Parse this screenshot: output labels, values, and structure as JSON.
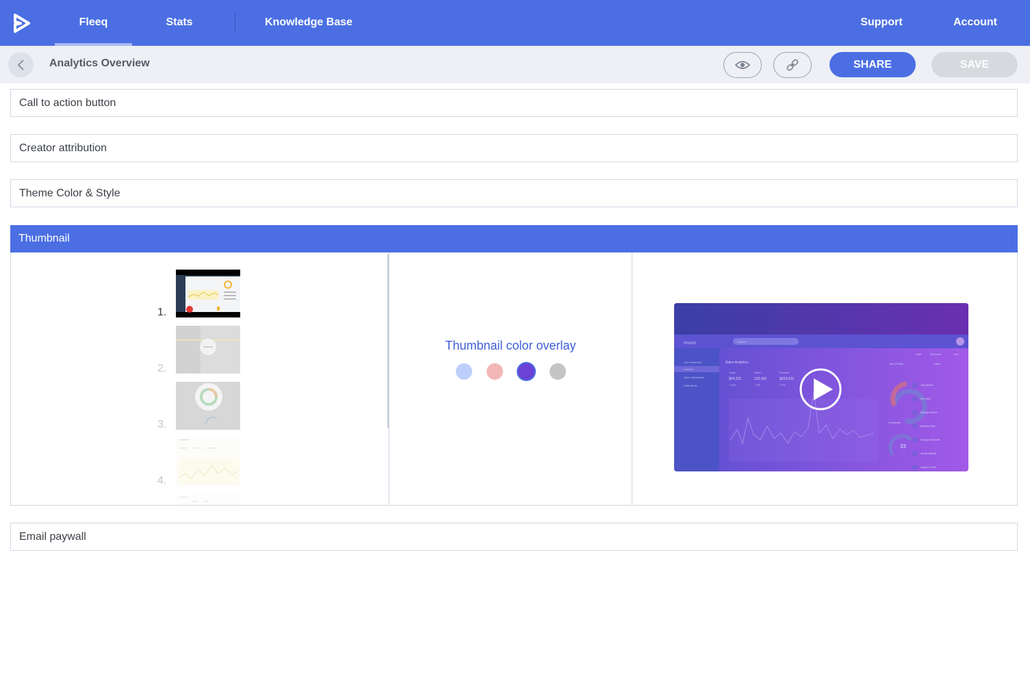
{
  "nav": {
    "items": [
      "Fleeq",
      "Stats",
      "Knowledge Base"
    ],
    "right_items": [
      "Support",
      "Account"
    ],
    "accent": "#4b6fe3"
  },
  "toolbar": {
    "title": "Analytics Overview",
    "share_label": "SHARE",
    "save_label": "SAVE"
  },
  "sections": {
    "cta": "Call to action button",
    "creator": "Creator attribution",
    "theme": "Theme Color & Style",
    "thumbnail": "Thumbnail",
    "email": "Email paywall"
  },
  "thumbnail": {
    "frames": [
      "1.",
      "2.",
      "3.",
      "4."
    ],
    "selected_frame": 1,
    "overlay_title": "Thumbnail color overlay",
    "overlay_colors": [
      "#bdd0fb",
      "#f3b7b7",
      "#6a43d6",
      "#c4c4c4"
    ],
    "selected_overlay": "#6a43d6",
    "preview": {
      "app_name": "Hound",
      "search_placeholder": "Search",
      "section_title": "Sales Analytics",
      "stats": [
        {
          "label": "Today",
          "value": "$24,222",
          "delta": "+ 10%"
        },
        {
          "label": "Active",
          "value": "123,432",
          "delta": "+ 4%"
        },
        {
          "label": "Revenue",
          "value": "$324,222",
          "delta": "+ 4%"
        }
      ],
      "sidebar_items": [
        "Your Dashboard",
        "Analytics",
        "Sales Optimization",
        "Notifications"
      ],
      "panel_title": "Top 5 Posts",
      "panel_tabs": [
        "Chat",
        "Messages",
        "Todo"
      ],
      "panel_select": "Users",
      "contacts": [
        "Clay Morris",
        "Zoe Hine",
        "Madelyn Burton",
        "Miranda Reid",
        "Claryard Meredith",
        "Jennie Metcalf",
        "Angela Lowell"
      ],
      "conversion_label": "Conversion",
      "gauge_value": "33"
    }
  }
}
